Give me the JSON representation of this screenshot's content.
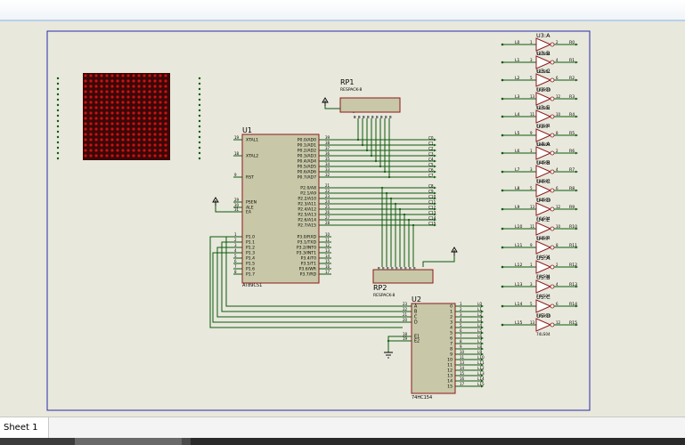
{
  "tab": {
    "label": "Sheet 1"
  },
  "colors": {
    "wire": "#0b5a0b",
    "chip_fill": "#c8c8a8",
    "chip_border": "#8b1a1a",
    "led": "#cc1010",
    "frame": "#2a2aaa",
    "text": "#000000"
  },
  "matrix": {
    "rows": 16,
    "cols": 16
  },
  "rp1": {
    "ref": "RP1",
    "value": "RESPACK-8"
  },
  "rp2": {
    "ref": "RP2",
    "value": "RESPACK-8"
  },
  "u1": {
    "ref": "U1",
    "part": "AT89C51",
    "left_pins": [
      {
        "num": "19",
        "name": "XTAL1"
      },
      {
        "num": "18",
        "name": "XTAL2"
      },
      {
        "num": "9",
        "name": "RST"
      },
      {
        "num": "29",
        "name": "PSEN"
      },
      {
        "num": "30",
        "name": "ALE"
      },
      {
        "num": "31",
        "name": "EA"
      },
      {
        "num": "1",
        "name": "P1.0"
      },
      {
        "num": "2",
        "name": "P1.1"
      },
      {
        "num": "3",
        "name": "P1.2"
      },
      {
        "num": "4",
        "name": "P1.3"
      },
      {
        "num": "5",
        "name": "P1.4"
      },
      {
        "num": "6",
        "name": "P1.5"
      },
      {
        "num": "7",
        "name": "P1.6"
      },
      {
        "num": "8",
        "name": "P1.7"
      }
    ],
    "right_pins": [
      {
        "num": "39",
        "name": "P0.0/AD0"
      },
      {
        "num": "38",
        "name": "P0.1/AD1"
      },
      {
        "num": "37",
        "name": "P0.2/AD2"
      },
      {
        "num": "36",
        "name": "P0.3/AD3"
      },
      {
        "num": "35",
        "name": "P0.4/AD4"
      },
      {
        "num": "34",
        "name": "P0.5/AD5"
      },
      {
        "num": "33",
        "name": "P0.6/AD6"
      },
      {
        "num": "32",
        "name": "P0.7/AD7"
      },
      {
        "num": "21",
        "name": "P2.0/A8"
      },
      {
        "num": "22",
        "name": "P2.1/A9"
      },
      {
        "num": "23",
        "name": "P2.2/A10"
      },
      {
        "num": "24",
        "name": "P2.3/A11"
      },
      {
        "num": "25",
        "name": "P2.4/A12"
      },
      {
        "num": "26",
        "name": "P2.5/A13"
      },
      {
        "num": "27",
        "name": "P2.6/A14"
      },
      {
        "num": "28",
        "name": "P2.7/A15"
      },
      {
        "num": "10",
        "name": "P3.0/RXD"
      },
      {
        "num": "11",
        "name": "P3.1/TXD"
      },
      {
        "num": "12",
        "name": "P3.2/INT0"
      },
      {
        "num": "13",
        "name": "P3.3/INT1"
      },
      {
        "num": "14",
        "name": "P3.4/T0"
      },
      {
        "num": "15",
        "name": "P3.5/T1"
      },
      {
        "num": "16",
        "name": "P3.6/WR"
      },
      {
        "num": "17",
        "name": "P3.7/RD"
      }
    ]
  },
  "u2": {
    "ref": "U2",
    "part": "74HC154",
    "inputs": [
      {
        "num": "23",
        "name": "A"
      },
      {
        "num": "22",
        "name": "B"
      },
      {
        "num": "21",
        "name": "C"
      },
      {
        "num": "20",
        "name": "D"
      },
      {
        "num": "18",
        "name": "E1"
      },
      {
        "num": "19",
        "name": "E2"
      }
    ],
    "outputs": [
      {
        "num": "1",
        "name": "0",
        "net": "L0"
      },
      {
        "num": "2",
        "name": "1",
        "net": "L1"
      },
      {
        "num": "3",
        "name": "2",
        "net": "L2"
      },
      {
        "num": "4",
        "name": "3",
        "net": "L3"
      },
      {
        "num": "5",
        "name": "4",
        "net": "L4"
      },
      {
        "num": "6",
        "name": "5",
        "net": "L5"
      },
      {
        "num": "7",
        "name": "6",
        "net": "L6"
      },
      {
        "num": "8",
        "name": "7",
        "net": "L7"
      },
      {
        "num": "9",
        "name": "8",
        "net": "L8"
      },
      {
        "num": "10",
        "name": "9",
        "net": "L9"
      },
      {
        "num": "11",
        "name": "10",
        "net": "L10"
      },
      {
        "num": "13",
        "name": "11",
        "net": "L11"
      },
      {
        "num": "14",
        "name": "12",
        "net": "L12"
      },
      {
        "num": "15",
        "name": "13",
        "net": "L13"
      },
      {
        "num": "16",
        "name": "14",
        "net": "L14"
      },
      {
        "num": "17",
        "name": "15",
        "net": "L15"
      }
    ]
  },
  "port_nets": [
    "C0",
    "C1",
    "C2",
    "C3",
    "C4",
    "C5",
    "C6",
    "C7",
    "C8",
    "C9",
    "C10",
    "C11",
    "C12",
    "C13",
    "C14",
    "C15"
  ],
  "inverters": [
    {
      "ref": "U3:A",
      "part": "74LS04",
      "in_net": "L0",
      "out_net": "R0",
      "in_pin": "1",
      "out_pin": "2"
    },
    {
      "ref": "U3:B",
      "part": "74LS04",
      "in_net": "L1",
      "out_net": "R1",
      "in_pin": "3",
      "out_pin": "4"
    },
    {
      "ref": "U3:C",
      "part": "74LS04",
      "in_net": "L2",
      "out_net": "R2",
      "in_pin": "5",
      "out_pin": "6"
    },
    {
      "ref": "U3:D",
      "part": "74LS04",
      "in_net": "L3",
      "out_net": "R3",
      "in_pin": "13",
      "out_pin": "12"
    },
    {
      "ref": "U3:E",
      "part": "74LS04",
      "in_net": "L4",
      "out_net": "R4",
      "in_pin": "11",
      "out_pin": "10"
    },
    {
      "ref": "U3:F",
      "part": "74LS04",
      "in_net": "L5",
      "out_net": "R5",
      "in_pin": "9",
      "out_pin": "8"
    },
    {
      "ref": "U4:A",
      "part": "74LS04",
      "in_net": "L6",
      "out_net": "R6",
      "in_pin": "1",
      "out_pin": "2"
    },
    {
      "ref": "U4:B",
      "part": "74LS04",
      "in_net": "L7",
      "out_net": "R7",
      "in_pin": "3",
      "out_pin": "4"
    },
    {
      "ref": "U4:C",
      "part": "74LS04",
      "in_net": "L8",
      "out_net": "R8",
      "in_pin": "5",
      "out_pin": "6"
    },
    {
      "ref": "U4:D",
      "part": "74LS04",
      "in_net": "L9",
      "out_net": "R9",
      "in_pin": "13",
      "out_pin": "12"
    },
    {
      "ref": "U4:E",
      "part": "74LS04",
      "in_net": "L10",
      "out_net": "R10",
      "in_pin": "11",
      "out_pin": "10"
    },
    {
      "ref": "U4:F",
      "part": "74LS04",
      "in_net": "L11",
      "out_net": "R11",
      "in_pin": "9",
      "out_pin": "8"
    },
    {
      "ref": "U5:A",
      "part": "74LS04",
      "in_net": "L12",
      "out_net": "R12",
      "in_pin": "1",
      "out_pin": "2"
    },
    {
      "ref": "U5:B",
      "part": "74LS04",
      "in_net": "L13",
      "out_net": "R13",
      "in_pin": "3",
      "out_pin": "4"
    },
    {
      "ref": "U5:C",
      "part": "74LS04",
      "in_net": "L14",
      "out_net": "R14",
      "in_pin": "5",
      "out_pin": "6"
    },
    {
      "ref": "U5:D",
      "part": "74LS04",
      "in_net": "L15",
      "out_net": "R15",
      "in_pin": "13",
      "out_pin": "12"
    }
  ]
}
